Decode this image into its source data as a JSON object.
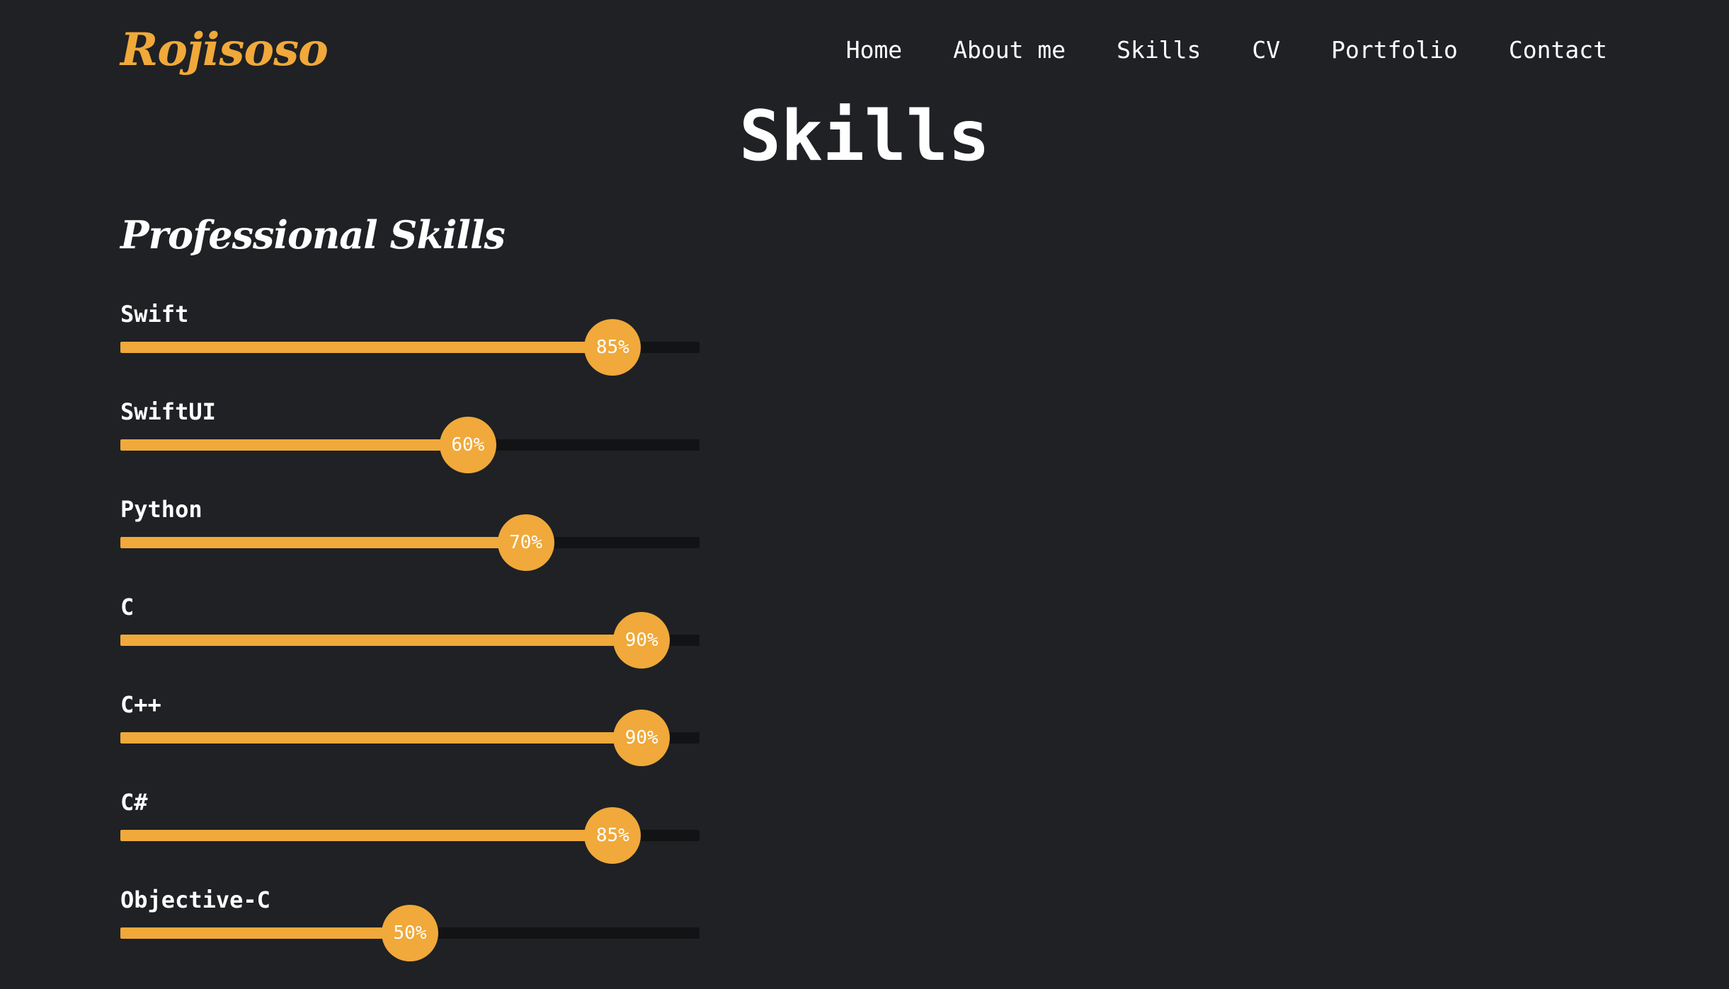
{
  "brand": {
    "logo_text": "Rojisoso",
    "accent_color": "#f0a93a",
    "background_color": "#1f2124",
    "track_color": "#121314"
  },
  "nav": {
    "items": [
      {
        "label": "Home"
      },
      {
        "label": "About me"
      },
      {
        "label": "Skills"
      },
      {
        "label": "CV"
      },
      {
        "label": "Portfolio"
      },
      {
        "label": "Contact"
      }
    ]
  },
  "main": {
    "title": "Skills",
    "section_heading": "Professional Skills",
    "skills": [
      {
        "name": "Swift",
        "percent": 85,
        "label": "85%"
      },
      {
        "name": "SwiftUI",
        "percent": 60,
        "label": "60%"
      },
      {
        "name": "Python",
        "percent": 70,
        "label": "70%"
      },
      {
        "name": "C",
        "percent": 90,
        "label": "90%"
      },
      {
        "name": "C++",
        "percent": 90,
        "label": "90%"
      },
      {
        "name": "C#",
        "percent": 85,
        "label": "85%"
      },
      {
        "name": "Objective-C",
        "percent": 50,
        "label": "50%"
      }
    ]
  }
}
